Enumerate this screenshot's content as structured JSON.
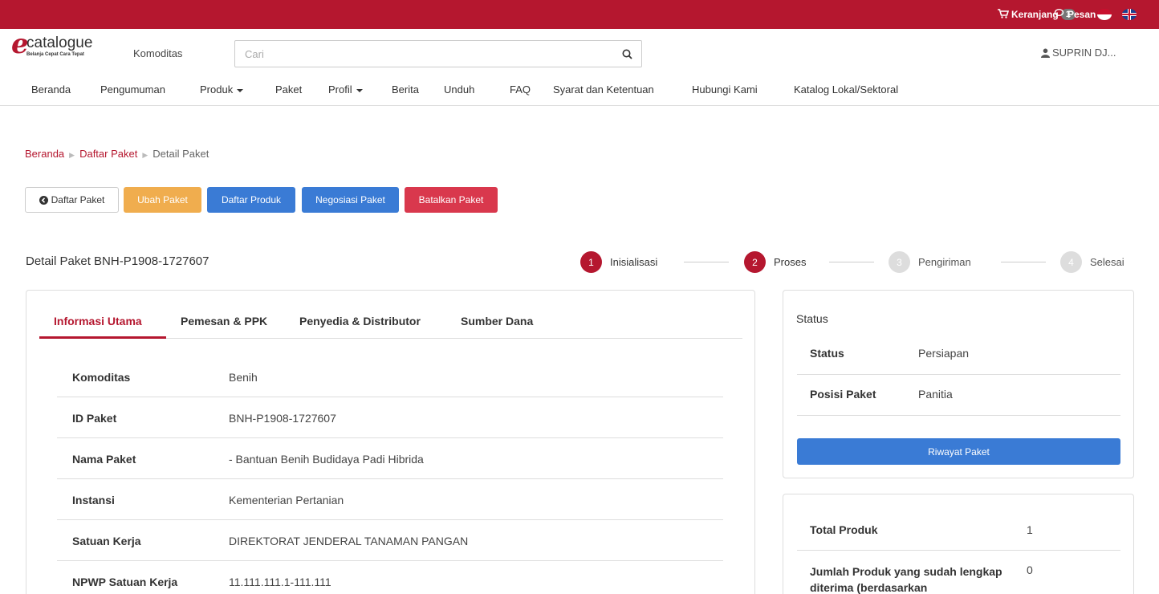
{
  "topbar": {
    "cart_label": "Keranjang",
    "cart_count": "1",
    "messages_label": "Pesan"
  },
  "header": {
    "logo_letter": "e",
    "logo_word": "catalogue",
    "logo_tagline": "Belanja Cepat Cara Tepat",
    "komoditas_label": "Komoditas",
    "search_placeholder": "Cari",
    "user_name": "SUPRIN DJ..."
  },
  "nav": {
    "items": [
      "Beranda",
      "Pengumuman",
      "Produk",
      "Paket",
      "Profil",
      "Berita",
      "Unduh",
      "FAQ",
      "Syarat dan Ketentuan",
      "Hubungi Kami",
      "Katalog Lokal/Sektoral"
    ]
  },
  "breadcrumb": {
    "home": "Beranda",
    "list": "Daftar Paket",
    "current": "Detail Paket"
  },
  "actions": {
    "back": "Daftar Paket",
    "edit": "Ubah Paket",
    "products": "Daftar Produk",
    "negotiate": "Negosiasi Paket",
    "cancel": "Batalkan Paket"
  },
  "page_title": "Detail Paket BNH-P1908-1727607",
  "steps": [
    {
      "num": "1",
      "label": "Inisialisasi",
      "active": true
    },
    {
      "num": "2",
      "label": "Proses",
      "active": true
    },
    {
      "num": "3",
      "label": "Pengiriman",
      "active": false
    },
    {
      "num": "4",
      "label": "Selesai",
      "active": false
    }
  ],
  "tabs": [
    "Informasi Utama",
    "Pemesan & PPK",
    "Penyedia & Distributor",
    "Sumber Dana"
  ],
  "details": [
    {
      "label": "Komoditas",
      "value": "Benih"
    },
    {
      "label": "ID Paket",
      "value": "BNH-P1908-1727607"
    },
    {
      "label": "Nama Paket",
      "value": "- Bantuan Benih Budidaya Padi Hibrida"
    },
    {
      "label": "Instansi",
      "value": "Kementerian Pertanian"
    },
    {
      "label": "Satuan Kerja",
      "value": "DIREKTORAT JENDERAL TANAMAN PANGAN"
    },
    {
      "label": "NPWP Satuan Kerja",
      "value": "11.111.111.1-111.111"
    }
  ],
  "status_panel": {
    "heading": "Status",
    "rows": [
      {
        "label": "Status",
        "value": "Persiapan"
      },
      {
        "label": "Posisi Paket",
        "value": "Panitia"
      }
    ],
    "history_button": "Riwayat Paket"
  },
  "totals": {
    "total_label": "Total Produk",
    "total_value": "1",
    "received_label": "Jumlah Produk yang sudah lengkap diterima (berdasarkan",
    "received_value": "0"
  },
  "colors": {
    "brand_red": "#b5172f",
    "primary_blue": "#3a7bd5",
    "warning_orange": "#f0ad4e",
    "danger_red": "#d9384d"
  }
}
